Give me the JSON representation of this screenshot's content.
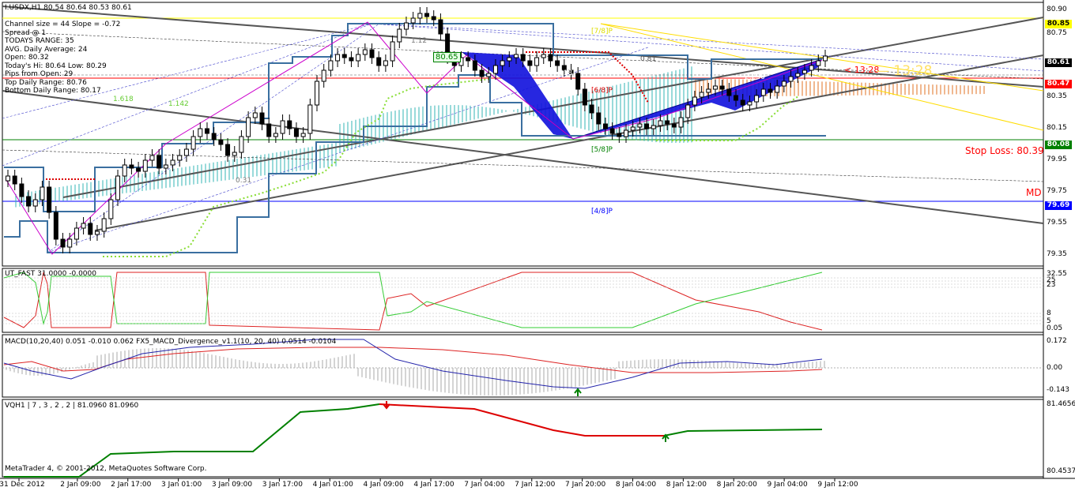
{
  "chart_data": {
    "type": "candlestick",
    "symbol": "I.USDX,H1",
    "ohlc_header": "80.54 80.64 80.53 80.61",
    "info_panel": [
      "Channel size = 44 Slope = -0.72",
      "Spread @ 1",
      "TODAYS RANGE: 35",
      "AVG. Daily Average: 24",
      "Open: 80.32",
      "Today's Hi: 80.64  Low: 80.29",
      "Pips from Open: 29",
      "Top Daily Range: 80.76",
      "Bottom Daily Range: 80.17"
    ],
    "price_axis_ticks": [
      "80.90",
      "80.75",
      "80.55",
      "80.35",
      "80.15",
      "79.95",
      "79.75",
      "79.55",
      "79.35"
    ],
    "price_boxes": [
      {
        "text": "80.85",
        "color": "#ffff00",
        "textColor": "#000000"
      },
      {
        "text": "80.61",
        "color": "#000000",
        "textColor": "#ffffff"
      },
      {
        "text": "80.47",
        "color": "#ff0000",
        "textColor": "#ffffff"
      },
      {
        "text": "80.08",
        "color": "#008000",
        "textColor": "#ffffff"
      },
      {
        "text": "79.69",
        "color": "#0000ff",
        "textColor": "#ffffff"
      }
    ],
    "murrey_levels": [
      "[7/8]P",
      "[6/8]P",
      "[5/8]P",
      "[4/8]P"
    ],
    "annotations": {
      "price_label": "80.65",
      "time_small": "< 13:28",
      "time_big": "— 13:28",
      "stop_loss": "Stop Loss: 80.39",
      "md": "MD",
      "fib_618": "618",
      "fib_0_81": "0.81",
      "fib_1_618": "1.618",
      "fib_1_142": "1.142",
      "fib_0_31": "0.31",
      "fib_2_236": "2.236",
      "fib_1_12": "1.12"
    },
    "time_axis": [
      "31 Dec 2012",
      "2 Jan 09:00",
      "2 Jan 17:00",
      "3 Jan 01:00",
      "3 Jan 09:00",
      "3 Jan 17:00",
      "4 Jan 01:00",
      "4 Jan 09:00",
      "4 Jan 17:00",
      "7 Jan 04:00",
      "7 Jan 12:00",
      "7 Jan 20:00",
      "8 Jan 04:00",
      "8 Jan 12:00",
      "8 Jan 20:00",
      "9 Jan 04:00",
      "9 Jan 12:00"
    ],
    "candles": [
      79.85,
      79.8,
      79.72,
      79.66,
      79.7,
      79.78,
      79.62,
      79.45,
      79.4,
      79.45,
      79.52,
      79.55,
      79.48,
      79.5,
      79.58,
      79.7,
      79.85,
      79.92,
      79.9,
      79.88,
      79.95,
      79.98,
      79.9,
      79.92,
      79.95,
      79.98,
      80.02,
      80.1,
      80.15,
      80.12,
      80.08,
      80.05,
      79.98,
      80.0,
      80.1,
      80.22,
      80.25,
      80.18,
      80.1,
      80.12,
      80.2,
      80.15,
      80.1,
      80.12,
      80.3,
      80.45,
      80.52,
      80.58,
      80.62,
      80.6,
      80.58,
      80.62,
      80.65,
      80.6,
      80.55,
      80.58,
      80.7,
      80.78,
      80.82,
      80.85,
      80.88,
      80.86,
      80.84,
      80.75,
      80.6,
      80.55,
      80.6,
      80.58,
      80.52,
      80.48,
      80.5,
      80.55,
      80.58,
      80.6,
      80.62,
      80.58,
      80.55,
      80.6,
      80.62,
      80.58,
      80.55,
      80.52,
      80.5,
      80.4,
      80.3,
      80.25,
      80.18,
      80.15,
      80.12,
      80.1,
      80.14,
      80.16,
      80.18,
      80.15,
      80.17,
      80.2,
      80.18,
      80.16,
      80.22,
      80.3,
      80.35,
      80.38,
      80.4,
      80.42,
      80.4,
      80.36,
      80.33,
      80.3,
      80.32,
      80.36,
      80.4,
      80.38,
      80.42,
      80.45,
      80.48,
      80.5,
      80.52,
      80.55,
      80.58,
      80.61
    ],
    "ut_fast": {
      "label": "UT_FAST 31.0000 -0.0000",
      "ticks": [
        "32.55",
        "25",
        "23",
        "8",
        "5",
        "0.05"
      ]
    },
    "macd": {
      "label": "MACD(10,20,40) 0.051 -0.010 0.062  FX5_MACD_Divergence_v1.1(10, 20, 40) 0.0514 -0.0104",
      "ticks": [
        "0.172",
        "0.00",
        "-0.143"
      ]
    },
    "vqh": {
      "label": "VQH1 | 7 , 3 , 2 , 2 | 81.0960 81.0960",
      "ticks": [
        "81.4656",
        "80.4537"
      ]
    },
    "copyright": "MetaTrader 4, © 2001-2012, MetaQuotes Software Corp."
  }
}
